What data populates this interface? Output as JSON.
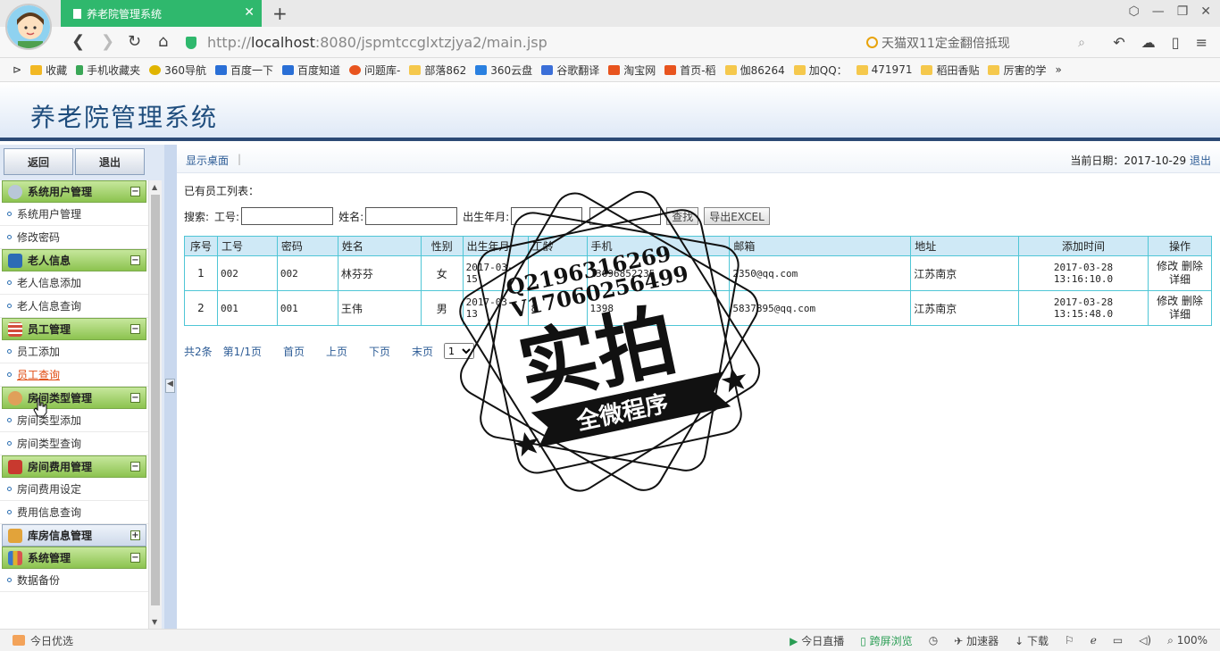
{
  "browser": {
    "tab_title": "养老院管理系统",
    "url_prefix": "http://",
    "url_host": "localhost",
    "url_rest": ":8080/jspmtccglxtzjya2/main.jsp",
    "search_text": "天猫双11定金翻倍抵现",
    "bookmarks": [
      "收藏",
      "手机收藏夹",
      "360导航",
      "百度一下",
      "百度知道",
      "问题库-",
      "部落862",
      "360云盘",
      "谷歌翻译",
      "淘宝网",
      "首页-稻",
      "伽86264",
      "加QQ：",
      "471971",
      "稻田香贴",
      "厉害的学"
    ]
  },
  "app": {
    "title": "养老院管理系统"
  },
  "sidebar": {
    "back_label": "返回",
    "logout_label": "退出",
    "groups": [
      {
        "title": "系统用户管理",
        "toggle": "−",
        "items": [
          "系统用户管理",
          "修改密码"
        ]
      },
      {
        "title": "老人信息",
        "toggle": "−",
        "items": [
          "老人信息添加",
          "老人信息查询"
        ]
      },
      {
        "title": "员工管理",
        "toggle": "−",
        "items": [
          "员工添加",
          "员工查询"
        ]
      },
      {
        "title": "房间类型管理",
        "toggle": "−",
        "items": [
          "房间类型添加",
          "房间类型查询"
        ]
      },
      {
        "title": "房间费用管理",
        "toggle": "−",
        "items": [
          "房间费用设定",
          "费用信息查询"
        ]
      },
      {
        "title": "库房信息管理",
        "toggle": "+",
        "items": []
      },
      {
        "title": "系统管理",
        "toggle": "−",
        "items": [
          "数据备份"
        ]
      }
    ]
  },
  "main": {
    "desktop_link": "显示桌面",
    "date_label": "当前日期：2017-10-29",
    "date_logout": "退出",
    "list_title": "已有员工列表：",
    "search": {
      "label": "搜索:",
      "id_label": "工号:",
      "name_label": "姓名:",
      "birth_label": "出生年月:",
      "query_btn": "查找",
      "export_btn": "导出EXCEL"
    },
    "table": {
      "headers": [
        "序号",
        "工号",
        "密码",
        "姓名",
        "性别",
        "出生年月",
        "工龄",
        "手机",
        "邮箱",
        "地址",
        "添加时间",
        "操作"
      ],
      "rows": [
        {
          "no": "1",
          "id": "002",
          "pwd": "002",
          "name": "林芬芬",
          "sex": "女",
          "birth": "2017-03-15",
          "years": "",
          "phone": "13696852235",
          "email": "2350@qq.com",
          "addr": "江苏南京",
          "added": "2017-03-28 13:16:10.0",
          "edit": "修改",
          "del": "删除",
          "detail": "详细"
        },
        {
          "no": "2",
          "id": "001",
          "pwd": "001",
          "name": "王伟",
          "sex": "男",
          "birth": "2017-03-13",
          "years": "8",
          "phone": "1398",
          "email": "5837895@qq.com",
          "addr": "江苏南京",
          "added": "2017-03-28 13:15:48.0",
          "edit": "修改",
          "del": "删除",
          "detail": "详细"
        }
      ]
    },
    "pager": {
      "total": "共2条",
      "page": "第1/1页",
      "first": "首页",
      "prev": "上页",
      "next": "下页",
      "last": "末页",
      "select": "1"
    }
  },
  "watermark": {
    "line1": "Q2196316269",
    "line2": "V17060256499",
    "big": "实拍",
    "banner": "全微程序"
  },
  "statusbar": {
    "left": "今日优选",
    "live": "今日直播",
    "cross": "跨屏浏览",
    "speed": "加速器",
    "download": "下载",
    "zoom": "100%"
  }
}
